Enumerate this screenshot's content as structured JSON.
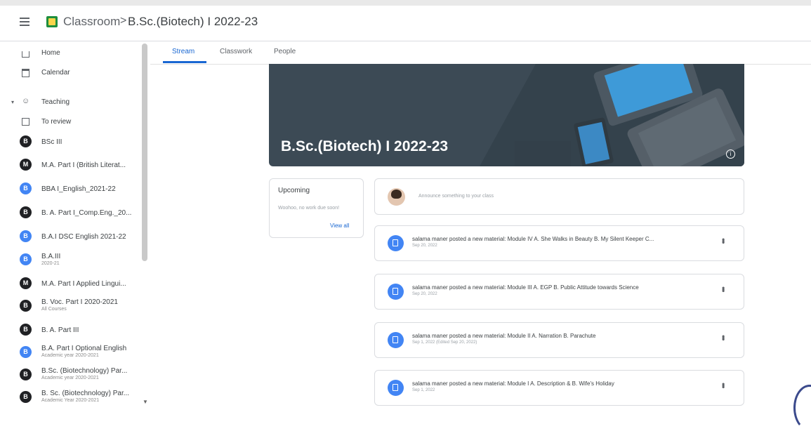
{
  "header": {
    "app_title": "Classroom",
    "separator": ">",
    "crumb": "B.Sc.(Biotech) I 2022-23",
    "menu_icon": "hamburger-menu-icon",
    "logo_icon": "classroom-logo-icon"
  },
  "sidebar": {
    "home": "Home",
    "calendar": "Calendar",
    "teaching": "Teaching",
    "to_review": "To review",
    "classes": [
      {
        "initial": "B",
        "name": "BSc III",
        "sub": "",
        "color": "#202124"
      },
      {
        "initial": "M",
        "name": "M.A. Part I (British Literat...",
        "sub": "",
        "color": "#202124"
      },
      {
        "initial": "B",
        "name": "BBA I_English_2021-22",
        "sub": "",
        "color": "#4285f4"
      },
      {
        "initial": "B",
        "name": "B. A. Part I_Comp.Eng._20...",
        "sub": "",
        "color": "#202124"
      },
      {
        "initial": "B",
        "name": "B.A.I DSC English 2021-22",
        "sub": "",
        "color": "#4285f4"
      },
      {
        "initial": "B",
        "name": "B.A.III",
        "sub": "2020-21",
        "color": "#4285f4"
      },
      {
        "initial": "M",
        "name": "M.A. Part I Applied Lingui...",
        "sub": "",
        "color": "#202124"
      },
      {
        "initial": "B",
        "name": "B. Voc. Part I 2020-2021",
        "sub": "All Courses",
        "color": "#202124"
      },
      {
        "initial": "B",
        "name": "B. A. Part III",
        "sub": "",
        "color": "#202124"
      },
      {
        "initial": "B",
        "name": "B.A. Part I Optional English",
        "sub": "Academic year 2020-2021",
        "color": "#4285f4"
      },
      {
        "initial": "B",
        "name": "B.Sc. (Biotechnology) Par...",
        "sub": "Academic year 2020-2021",
        "color": "#202124"
      },
      {
        "initial": "B",
        "name": "B. Sc. (Biotechnology) Par...",
        "sub": "Academic Year 2020-2021",
        "color": "#202124"
      }
    ]
  },
  "tabs": [
    "Stream",
    "Classwork",
    "People"
  ],
  "banner": {
    "title": "B.Sc.(Biotech) I 2022-23",
    "info_icon": "info-icon"
  },
  "upcoming": {
    "heading": "Upcoming",
    "message": "Woohoo, no work due soon!",
    "link": "View all"
  },
  "announce": {
    "placeholder": "Announce something to your class"
  },
  "posts": [
    {
      "text": "salama maner posted a new material: Module IV A. She Walks in Beauty B. My Silent Keeper C...",
      "date": "Sep 20, 2022"
    },
    {
      "text": "salama maner posted a new material: Module III A. EGP B. Public Attitude towards Science",
      "date": "Sep 20, 2022"
    },
    {
      "text": "salama maner posted a new material: Module II A. Narration B. Parachute",
      "date": "Sep 1, 2022 (Edited Sep 20, 2022)"
    },
    {
      "text": "salama maner posted a new material: Module I A. Description & B. Wife's Holiday",
      "date": "Sep 1, 2022"
    }
  ],
  "colors": {
    "accent": "#1967d2",
    "avatar_dark": "#202124",
    "avatar_blue": "#4285f4",
    "banner": "#3c4a55"
  }
}
